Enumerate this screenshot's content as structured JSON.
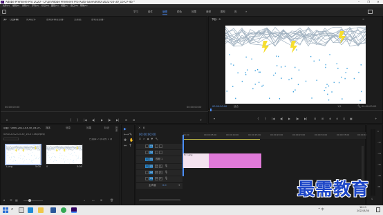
{
  "app": {
    "logo_text": "Pr",
    "title": "Adobe Premiere Pro 2020 - D:\\pr\\Adobe Premiere Pro Auto-Save\\0000-2022-03-30_16-07-46 *",
    "window_controls": [
      "–",
      "❐",
      "✕"
    ]
  },
  "menu": [
    "文件(F)",
    "编辑(E)",
    "剪辑(C)",
    "序列(S)",
    "标记(M)",
    "图形(G)",
    "视图(V)",
    "窗口(W)",
    "帮助(H)"
  ],
  "workspaces": {
    "items": [
      "学习",
      "组件",
      "编辑",
      "颜色",
      "效果",
      "音频",
      "图形",
      "库"
    ],
    "active_index": 2,
    "more": "»"
  },
  "source_panel": {
    "tabs": [
      "源：（无剪辑）",
      "效果控件",
      "音频剪辑混合器：",
      "元数据",
      "音轨混合器："
    ],
    "tc_left": "00:00:00:00",
    "tc_right": "00:00:00:00",
    "controls": [
      "▾",
      "{",
      "}",
      "|◀",
      "◀|",
      "▶",
      "|▶",
      "▶|",
      "⊟",
      "⊞",
      "+"
    ]
  },
  "program_panel": {
    "tab": "节目：0",
    "tc_left": "00:00:00:00",
    "fit": "适合",
    "quality": "1/2",
    "tc_right": "00:00:00:00",
    "controls": [
      "▾",
      "{",
      "}",
      "|◀",
      "◀|",
      "▶",
      "|▶",
      "▶|",
      "⊟",
      "⊞",
      "⊕",
      "⊖",
      "⊡",
      "▣",
      "+"
    ]
  },
  "project_panel": {
    "tabs": [
      "项目：0000-2022-03-30_16-07-46",
      "媒体",
      "信息",
      "效果",
      "标记",
      "历史"
    ],
    "path": "0000-2022-03-30_16-07-46.prproj",
    "count": "已选择 2 项中的 1 项",
    "items": [
      {
        "name": "1.png",
        "duration": "5:00"
      },
      {
        "name": "0",
        "duration": "5:00"
      }
    ]
  },
  "tools": [
    "▶",
    "⟷",
    "✥",
    "⇔",
    "✎",
    "✋",
    "T"
  ],
  "timeline": {
    "tab": "0",
    "tc": "00:00:00:00",
    "ruler": [
      "00:00",
      "00:00:05:00",
      "00:00:10:00",
      "00:00:15:00",
      "00:00:20:00",
      "00:00:25:00",
      "00:00:30:00",
      "00:00:35:00",
      "00:00:40:00"
    ],
    "tracks": {
      "v": [
        "V3",
        "V2",
        "V1"
      ],
      "a": [
        "A1",
        "A2",
        "A3"
      ],
      "video1_label": "视频 1",
      "master": "主声道",
      "master_val": "0.0"
    },
    "clip_label": "fx 1.png",
    "colors": {
      "clip_a": "#f4e2ef",
      "clip_b": "#e07ad8",
      "accent": "#2f86c7"
    }
  },
  "audio_meter": {
    "labels": [
      "0",
      "-12",
      "-24",
      "-36",
      "-48",
      "dB"
    ],
    "sr": "S"
  },
  "taskbar": {
    "time": "16:11",
    "date": "2022/3/30",
    "tray": "^ 中"
  },
  "watermark": "最需教育",
  "frame_colors": {
    "lines": "#9fb0bf",
    "blue": "#3aa0dd",
    "yellow": "#f6de2e"
  }
}
